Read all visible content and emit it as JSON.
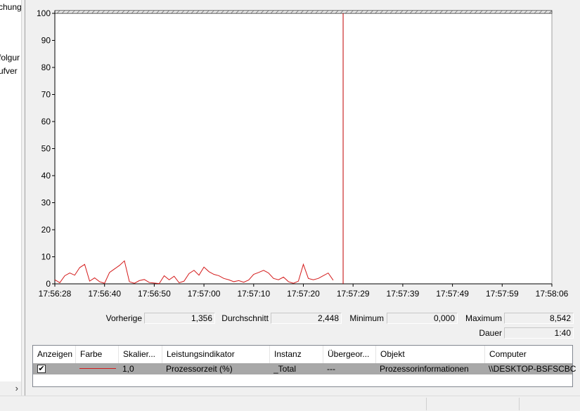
{
  "tree": {
    "items": [
      "chung",
      "folgur",
      "ufver"
    ],
    "scroll_arrow": "›"
  },
  "chart_data": {
    "type": "line",
    "series": [
      {
        "color": "#d41a1a",
        "x_seconds": [
          0,
          1,
          2,
          3,
          4,
          5,
          6,
          7,
          8,
          9,
          10,
          11,
          12,
          13,
          14,
          15,
          16,
          17,
          18,
          19,
          20,
          21,
          22,
          23,
          24,
          25,
          26,
          27,
          28,
          29,
          30,
          31,
          32,
          33,
          34,
          35,
          36,
          37,
          38,
          39,
          40,
          41,
          42,
          43,
          44,
          45,
          46,
          47,
          48,
          49,
          50,
          51,
          52,
          53,
          54,
          55,
          56,
          57,
          58
        ],
        "values": [
          1.5,
          0.4,
          3.0,
          4.0,
          3.2,
          6.0,
          7.2,
          1.0,
          2.2,
          0.8,
          0.2,
          4.2,
          5.5,
          6.8,
          8.5,
          0.8,
          0.2,
          1.2,
          1.6,
          0.5,
          0.3,
          0.1,
          3.0,
          1.5,
          2.8,
          0.4,
          1.0,
          3.8,
          5.0,
          3.2,
          6.2,
          4.5,
          3.5,
          3.0,
          2.0,
          1.5,
          0.8,
          1.2,
          0.6,
          1.4,
          3.5,
          4.2,
          5.0,
          4.0,
          2.0,
          1.5,
          2.5,
          0.8,
          0.2,
          1.0,
          7.2,
          2.0,
          1.5,
          2.0,
          3.0,
          4.0,
          1.356
        ]
      }
    ],
    "marker_x_seconds": 58,
    "ylim": [
      0,
      100
    ],
    "yticks": [
      "0",
      "10",
      "20",
      "30",
      "40",
      "50",
      "60",
      "70",
      "80",
      "90",
      "100"
    ],
    "xticks": [
      "17:56:28",
      "17:56:40",
      "17:56:50",
      "17:57:00",
      "17:57:10",
      "17:57:20",
      "17:57:29",
      "17:57:39",
      "17:57:49",
      "17:57:59",
      "17:58:06"
    ],
    "grid": false
  },
  "stats": {
    "last_label": "Vorherige",
    "last_value": "1,356",
    "avg_label": "Durchschnitt",
    "avg_value": "2,448",
    "min_label": "Minimum",
    "min_value": "0,000",
    "max_label": "Maximum",
    "max_value": "8,542",
    "duration_label": "Dauer",
    "duration_value": "1:40"
  },
  "table": {
    "headers": {
      "show": "Anzeigen",
      "color": "Farbe",
      "scale": "Skalier...",
      "counter": "Leistungsindikator",
      "instance": "Instanz",
      "parent": "Übergeor...",
      "object": "Objekt",
      "computer": "Computer"
    },
    "rows": [
      {
        "checked": "✔",
        "scale": "1,0",
        "counter": "Prozessorzeit (%)",
        "instance": "_Total",
        "parent": "---",
        "object": "Prozessorinformationen",
        "computer": "\\\\DESKTOP-BSFSCBC"
      }
    ]
  }
}
